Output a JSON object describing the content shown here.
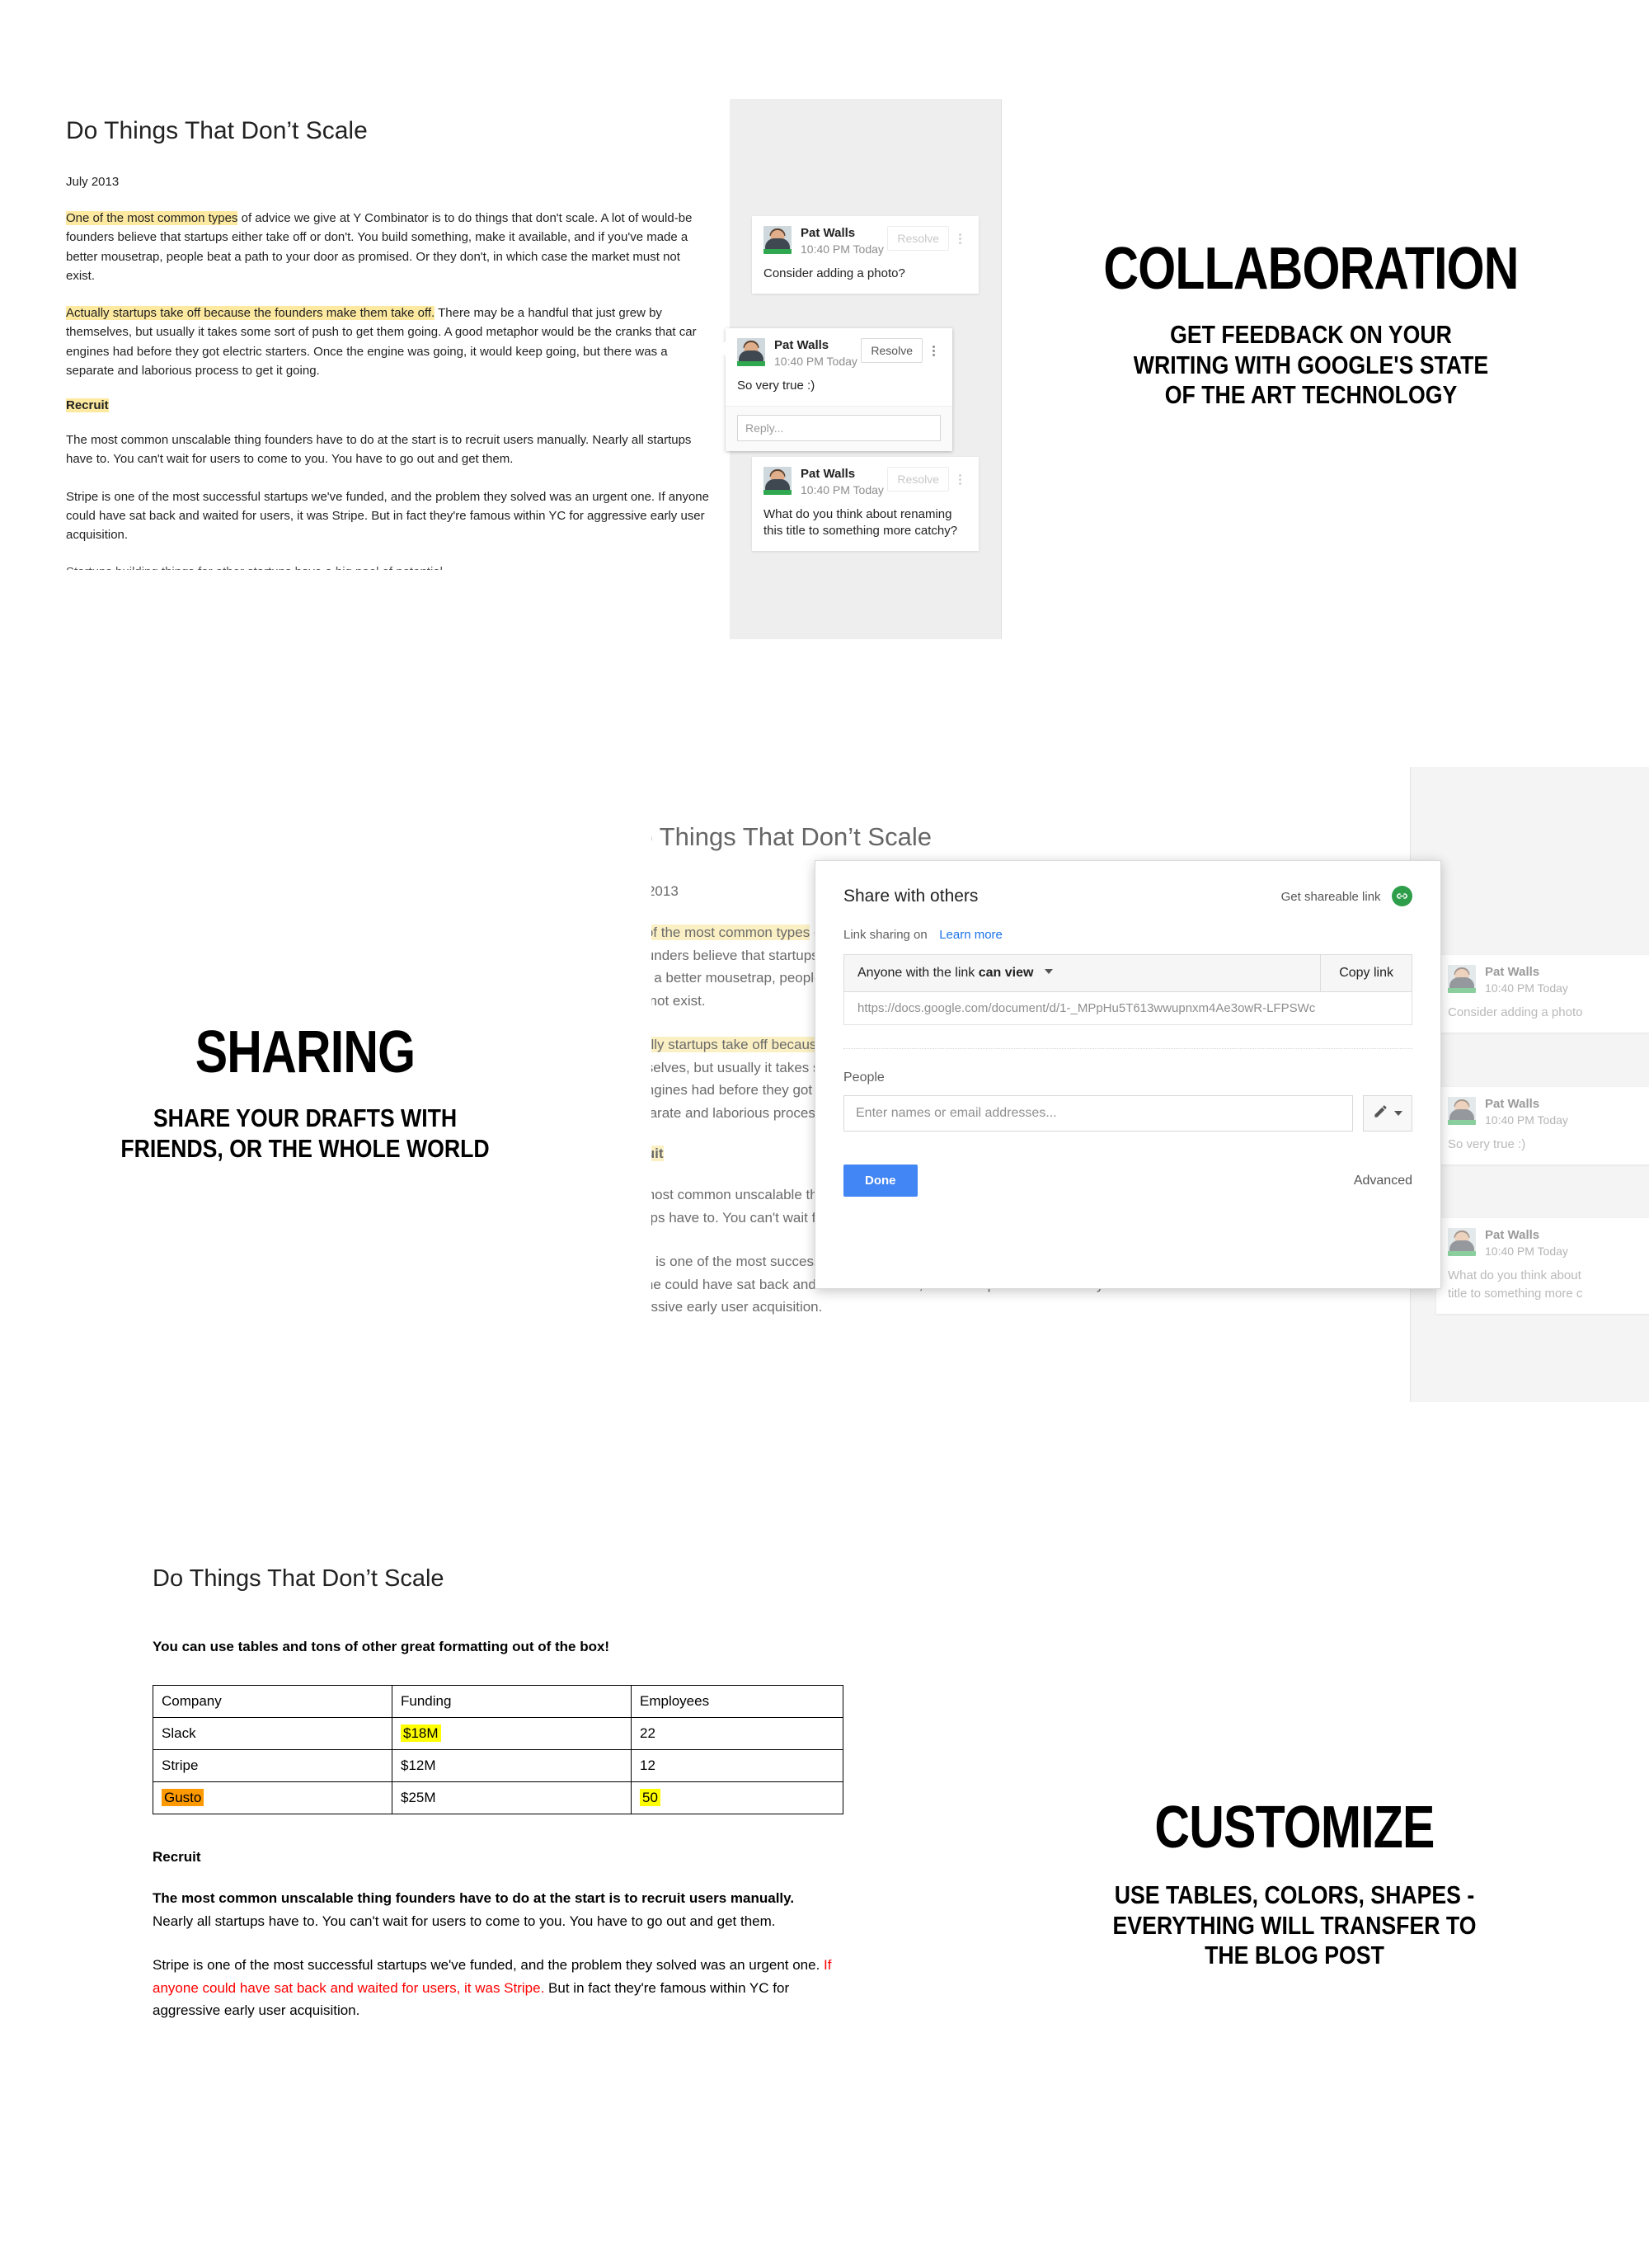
{
  "sections": [
    {
      "id": "collaboration",
      "promo_title": "COLLABORATION",
      "promo_sub_lines": [
        "GET FEEDBACK ON YOUR",
        "WRITING WITH GOOGLE'S STATE",
        "OF THE ART TECHNOLOGY"
      ]
    },
    {
      "id": "sharing",
      "promo_title": "SHARING",
      "promo_sub_lines": [
        "SHARE YOUR DRAFTS WITH",
        "FRIENDS, OR THE WHOLE WORLD"
      ]
    },
    {
      "id": "customize",
      "promo_title": "CUSTOMIZE",
      "promo_sub_lines": [
        "USE TABLES, COLORS, SHAPES -",
        "EVERYTHING WILL TRANSFER TO",
        "THE BLOG POST"
      ]
    }
  ],
  "document": {
    "title": "Do Things That Don’t Scale",
    "date": "July 2013",
    "p1_hl": "One of the most common types",
    "p1_rest": " of advice we give at Y Combinator is to do things that don't scale. A lot of would-be founders believe that startups either take off or don't. You build something, make it available, and if you've made a better mousetrap, people beat a path to your door as promised. Or they don't, in which case the market must not exist.",
    "p2_hl": "Actually startups take off because the founders make them take off.",
    "p2_rest": " There may be a handful that just grew by themselves, but usually it takes some sort of push to get them going. A good metaphor would be the cranks that car engines had before they got electric starters. Once the engine was going, it would keep going, but there was a separate and laborious process to get it going.",
    "h_recruit": "Recruit",
    "p3": "The most common unscalable thing founders have to do at the start is to recruit users manually. Nearly all startups have to. You can't wait for users to come to you. You have to go out and get them.",
    "p4": "Stripe is one of the most successful startups we've funded, and the problem they solved was an urgent one. If anyone could have sat back and waited for users, it was Stripe. But in fact they're famous within YC for aggressive early user acquisition.",
    "p5_clipped": "Startups building things for other startups have a big pool of potential"
  },
  "comments": {
    "author": "Pat Walls",
    "time": "10:40 PM Today",
    "resolve_label": "Resolve",
    "reply_placeholder": "Reply...",
    "items": [
      {
        "text": "Consider adding a photo?"
      },
      {
        "text": "So very true :)"
      },
      {
        "text": "What do you think about renaming this title to something more catchy?"
      }
    ],
    "items_clipped": [
      {
        "text": "Consider adding a photo"
      },
      {
        "text": "So very true :)"
      },
      {
        "text": "What do you think about",
        "text2": "title to something more c"
      }
    ]
  },
  "share_dialog": {
    "title": "Share with others",
    "shareable_link_label": "Get shareable link",
    "link_icon": "link-chain-icon",
    "link_sharing_label": "Link sharing on",
    "learn_more": "Learn more",
    "permission_prefix": "Anyone with the link ",
    "permission_value": "can view",
    "copy_link_label": "Copy link",
    "url": "https://docs.google.com/document/d/1-_MPpHu5T613wwupnxm4Ae3owR-LFPSWc",
    "people_label": "People",
    "people_placeholder": "Enter names or email addresses...",
    "pencil_icon": "pencil-icon",
    "done_label": "Done",
    "advanced_label": "Advanced"
  },
  "customize_doc": {
    "title": "Do Things That Don’t Scale",
    "intro": "You can use tables and tons of other great formatting out of the box!",
    "table": {
      "headers": [
        "Company",
        "Funding",
        "Employees"
      ],
      "rows": [
        {
          "cells": [
            "Slack",
            "$18M",
            "22"
          ],
          "highlights": [
            "none",
            "yellow",
            "none"
          ]
        },
        {
          "cells": [
            "Stripe",
            "$12M",
            "12"
          ],
          "highlights": [
            "none",
            "none",
            "none"
          ]
        },
        {
          "cells": [
            "Gusto",
            "$25M",
            "50"
          ],
          "highlights": [
            "orange",
            "none",
            "yellow"
          ]
        }
      ]
    },
    "h_recruit": "Recruit",
    "p_bold": "The most common unscalable thing founders have to do at the start is to recruit users manually.",
    "p_rest": " Nearly all startups have to. You can't wait for users to come to you. You have to go out and get them.",
    "p2_a": "Stripe is one of the most successful startups we've funded, and the problem they solved was an urgent one. ",
    "p2_red": "If anyone could have sat back and waited for users, it was Stripe.",
    "p2_b": " But in fact they're famous within YC for aggressive early user acquisition."
  },
  "colors": {
    "highlight_yellow": "#fdeaa0",
    "table_yellow": "#ffff00",
    "table_orange": "#ff9900",
    "red_text": "#ff0000",
    "done_blue": "#4285f4",
    "link_blue": "#1a73e8",
    "avatar_green": "#2fa84f",
    "rail_gray": "#eeeeee"
  }
}
